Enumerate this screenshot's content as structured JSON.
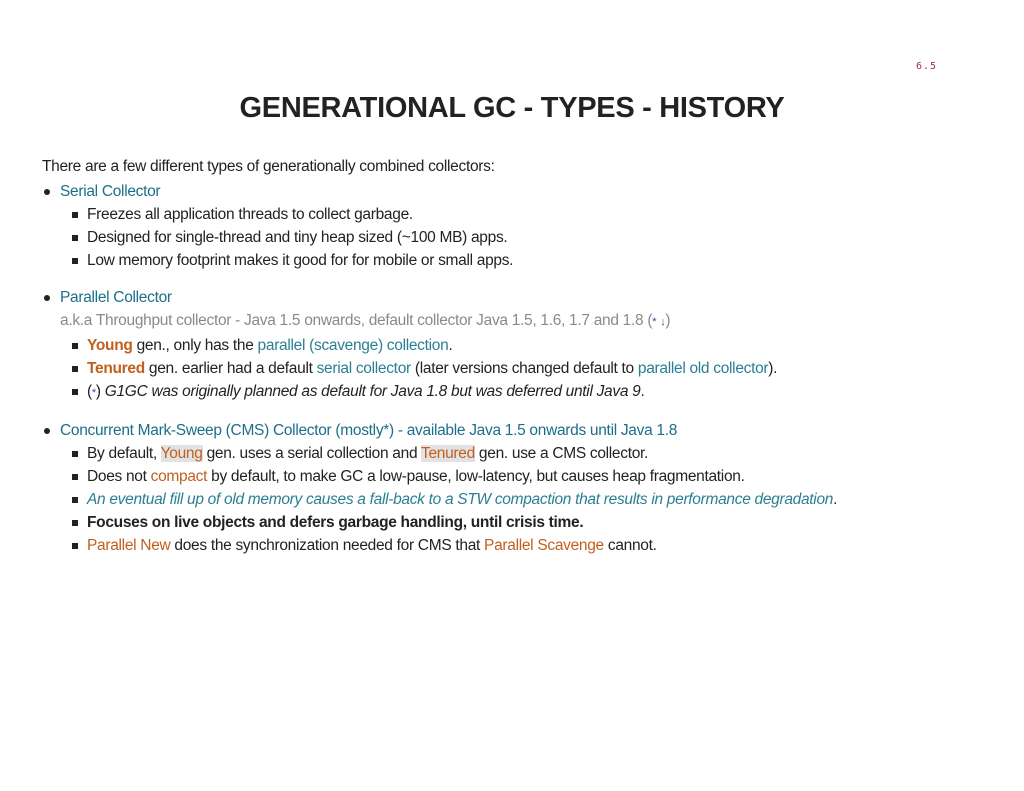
{
  "slide_number": "6.5",
  "title": "GENERATIONAL GC - TYPES - HISTORY",
  "intro": "There are a few different types of generationally combined collectors:",
  "sections": {
    "serial": {
      "heading": "Serial Collector",
      "items": [
        "Freezes all application threads to collect garbage.",
        "Designed for single-thread and tiny heap sized (~100 MB) apps.",
        "Low memory footprint makes it good for for mobile or small apps."
      ]
    },
    "parallel": {
      "heading": "Parallel Collector",
      "aka": "a.k.a Throughput collector - Java 1.5 onwards, default collector Java 1.5, 1.6, 1.7 and 1.8",
      "aka_open": " (",
      "aka_star": "*",
      "aka_arrow": "↓",
      "aka_close": ")",
      "item1": {
        "young": "Young",
        "mid": " gen., only has the ",
        "link": "parallel (scavenge) collection",
        "end": "."
      },
      "item2": {
        "tenured": "Tenured",
        "mid": " gen. earlier had a default ",
        "link1": "serial collector",
        "mid2": " (later versions changed default to ",
        "link2": "parallel old collector",
        "end": ")."
      },
      "item3": {
        "open": "(",
        "star": "*",
        "close": ") ",
        "text": "G1GC was originally planned as default for Java 1.8 but was deferred until Java 9",
        "end": "."
      }
    },
    "cms": {
      "heading": "Concurrent Mark-Sweep (CMS) Collector (mostly*) - available Java 1.5 onwards until Java 1.8",
      "item1": {
        "pre": "By default, ",
        "young": "Young",
        "mid": " gen. uses a serial collection and ",
        "tenured": "Tenured",
        "end": " gen. use a CMS collector."
      },
      "item2": {
        "pre": "Does not ",
        "compact": "compact",
        "end": " by default, to make GC a low-pause, low-latency, but causes heap fragmentation."
      },
      "item3": {
        "text": "An eventual fill up of old memory causes a fall-back to a STW compaction that results in performance degradation",
        "end": "."
      },
      "item4": "Focuses on live objects and defers garbage handling, until crisis time.",
      "item5": {
        "pn": "Parallel New",
        "mid": " does the synchronization needed for CMS that ",
        "ps": "Parallel Scavenge",
        "end": " cannot."
      }
    }
  }
}
